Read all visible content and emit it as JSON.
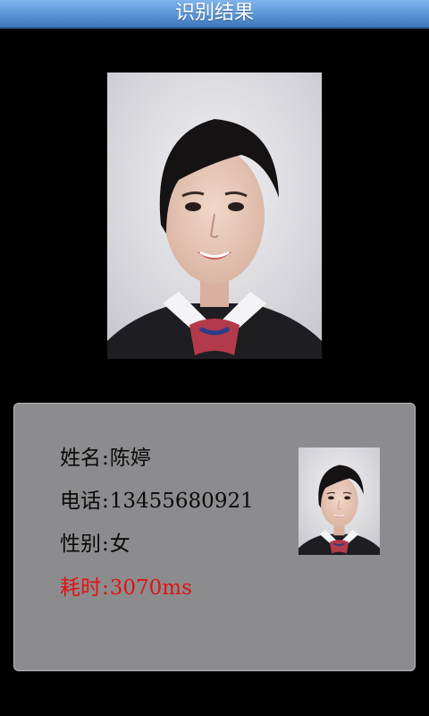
{
  "title_bar": {
    "title": "识别结果"
  },
  "result": {
    "name_label": "姓名",
    "name_value": "陈婷",
    "phone_label": "电话",
    "phone_value": "13455680921",
    "gender_label": "性别",
    "gender_value": "女",
    "time_label": "耗时",
    "time_value": "3070ms",
    "separator": ":"
  },
  "colors": {
    "title_bar": "#5b95d6",
    "panel": "#8c8c8e",
    "time_text": "#e21212"
  }
}
